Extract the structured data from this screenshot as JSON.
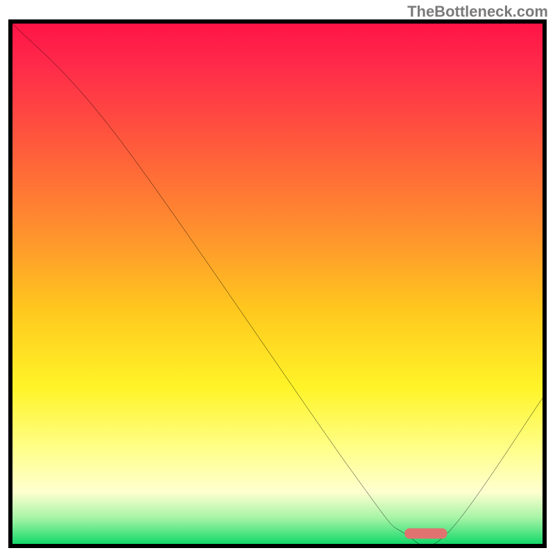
{
  "watermark": "TheBottleneck.com",
  "chart_data": {
    "type": "line",
    "title": "",
    "xlabel": "",
    "ylabel": "",
    "xlim": [
      0,
      100
    ],
    "ylim": [
      0,
      100
    ],
    "series": [
      {
        "name": "bottleneck-curve",
        "x": [
          0,
          20,
          64,
          74,
          82,
          100
        ],
        "y": [
          100,
          78,
          14,
          2,
          2,
          28
        ]
      }
    ],
    "marker": {
      "name": "optimal-range",
      "x_start": 74,
      "x_end": 82,
      "y": 2
    },
    "background_gradient": {
      "top": "#ff1446",
      "mid": "#fff428",
      "bottom": "#14d96a"
    }
  }
}
